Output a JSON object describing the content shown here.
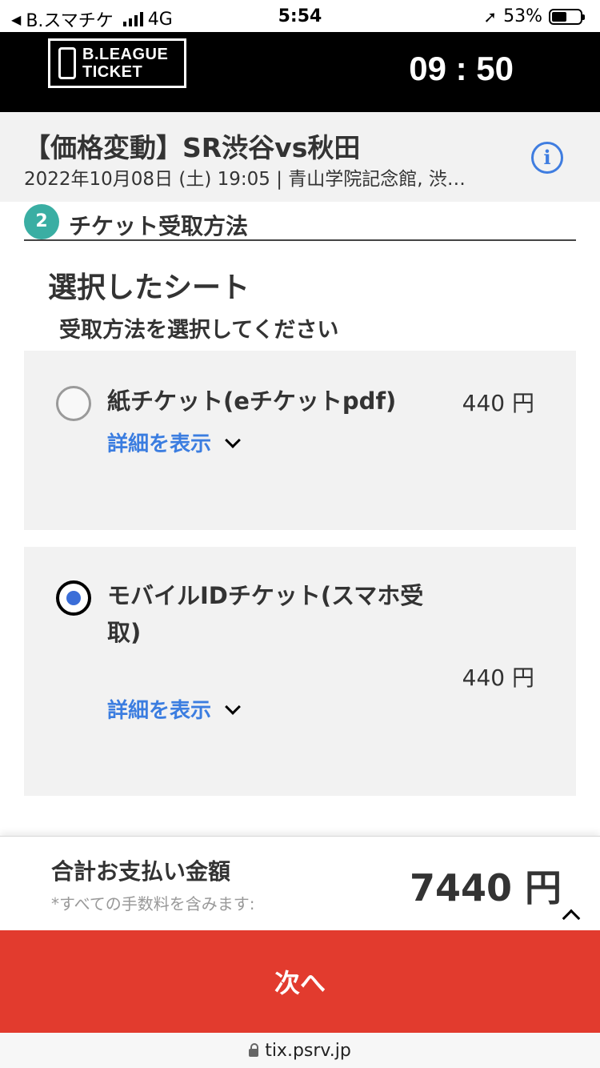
{
  "status_bar": {
    "back_app": "B.スマチケ",
    "network": "4G",
    "time": "5:54",
    "battery": "53%",
    "battery_level": 0.53
  },
  "header": {
    "logo_line1": "B.LEAGUE",
    "logo_line2": "TICKET",
    "timer": "09 : 50"
  },
  "event": {
    "title": "【価格変動】SR渋谷vs秋田",
    "subtitle": "2022年10月08日 (土) 19:05 | 青山学院記念館, 渋…",
    "info_glyph": "i"
  },
  "step": {
    "number": "2",
    "label": "チケット受取方法"
  },
  "main": {
    "heading": "選択したシート",
    "subheading": "受取方法を選択してください",
    "options": [
      {
        "name": "紙チケット(eチケットpdf)",
        "price": "440 円",
        "detail_label": "詳細を表示",
        "selected": false
      },
      {
        "name_line1": "モバイルIDチケット(スマホ受",
        "name_line2": "取)",
        "price": "440 円",
        "detail_label": "詳細を表示",
        "selected": true
      }
    ]
  },
  "footer": {
    "total_label": "合計お支払い金額",
    "total_note": "*すべての手数料を含みます:",
    "total_amount": "7440 円",
    "next_label": "次へ"
  },
  "browser": {
    "url": "tix.psrv.jp"
  },
  "colors": {
    "accent_blue": "#3b7de0",
    "step_teal": "#3aaea3",
    "next_red": "#e23b2e",
    "card_bg": "#f2f2f2"
  }
}
